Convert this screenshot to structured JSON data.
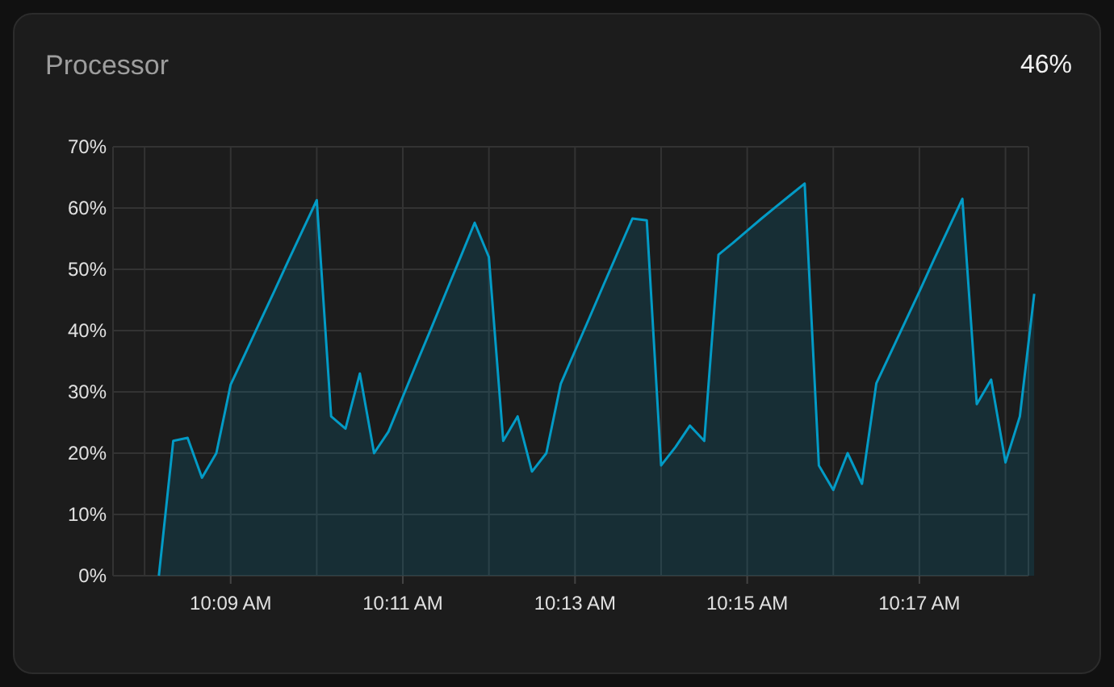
{
  "card": {
    "title": "Processor",
    "value": "46%",
    "chart_data": {
      "type": "area",
      "grid": true,
      "ylim": [
        0,
        70
      ],
      "yticks": [
        {
          "value": 0,
          "label": "0%"
        },
        {
          "value": 10,
          "label": "10%"
        },
        {
          "value": 20,
          "label": "20%"
        },
        {
          "value": 30,
          "label": "30%"
        },
        {
          "value": 40,
          "label": "40%"
        },
        {
          "value": 50,
          "label": "50%"
        },
        {
          "value": 60,
          "label": "60%"
        },
        {
          "value": 70,
          "label": "70%"
        }
      ],
      "categories": [
        null,
        null,
        null,
        null,
        null,
        null,
        "10:09 AM",
        null,
        null,
        null,
        null,
        null,
        null,
        null,
        null,
        null,
        null,
        null,
        "10:11 AM",
        null,
        null,
        null,
        null,
        null,
        null,
        null,
        null,
        null,
        null,
        null,
        "10:13 AM",
        null,
        null,
        null,
        null,
        null,
        null,
        null,
        null,
        null,
        null,
        null,
        "10:15 AM",
        null,
        null,
        null,
        null,
        null,
        null,
        null,
        null,
        null,
        null,
        null,
        "10:17 AM",
        null,
        null,
        null,
        null,
        null,
        null,
        null,
        null
      ],
      "series": [
        {
          "color": "#039bc6",
          "values": [
            null,
            0,
            22,
            22.5,
            16,
            20,
            31.2,
            36.2,
            41.2,
            46.2,
            51.3,
            56.3,
            61.3,
            26,
            24,
            33,
            20,
            23.5,
            29.2,
            34.9,
            40.5,
            46.2,
            51.9,
            57.6,
            52,
            22,
            26,
            17,
            20,
            31.3,
            36.7,
            42.1,
            47.5,
            52.9,
            58.3,
            58,
            18,
            21,
            24.5,
            22,
            52.4,
            54.3,
            56.3,
            58.3,
            60.2,
            62.1,
            64,
            18,
            14,
            20,
            15,
            31.4,
            36.4,
            41.4,
            46.4,
            51.5,
            56.5,
            61.5,
            28,
            32,
            18.5,
            26,
            46
          ]
        }
      ]
    }
  }
}
